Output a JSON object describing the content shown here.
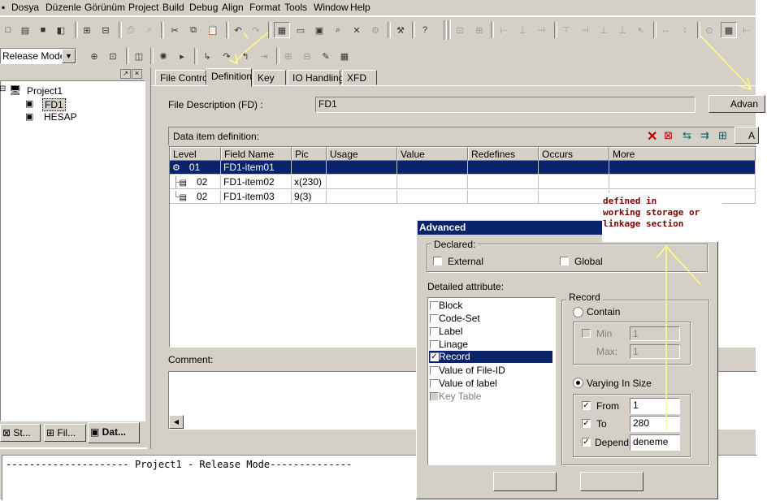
{
  "menubar": {
    "items": [
      "Dosya",
      "Düzenle",
      "Görünüm",
      "Project",
      "Build",
      "Debug",
      "Align",
      "Format",
      "Tools",
      "Window",
      "Help"
    ]
  },
  "toolbar2": {
    "mode_value": "Release Mode"
  },
  "tree": {
    "root": "Project1",
    "children": [
      "FD1",
      "HESAP"
    ]
  },
  "left_tabs": [
    "St...",
    "Fil...",
    "Dat..."
  ],
  "tabs": [
    "File Control",
    "Definition",
    "Key",
    "IO Handling",
    "XFD"
  ],
  "fd": {
    "label": "File Description (FD) :",
    "value": "FD1",
    "advanced_button": "Advan"
  },
  "data_item": {
    "label": "Data item definition:",
    "extra_button": "A",
    "columns": [
      "Level",
      "Field Name",
      "Pic",
      "Usage",
      "Value",
      "Redefines",
      "Occurs",
      "More"
    ],
    "rows": [
      {
        "level": "01",
        "name": "FD1-item01",
        "pic": ""
      },
      {
        "level": "02",
        "name": "FD1-item02",
        "pic": "x(230)"
      },
      {
        "level": "02",
        "name": "FD1-item03",
        "pic": "9(3)"
      }
    ]
  },
  "comment_label": "Comment:",
  "output": {
    "line": "--------------------- Project1 - Release Mode--------------"
  },
  "annotation": {
    "lines": [
      "defined in",
      "working storage or",
      "linkage section"
    ]
  },
  "dialog": {
    "title": "Advanced",
    "declared_label": "Declared:",
    "external_label": "External",
    "global_label": "Global",
    "detailed_label": "Detailed attribute:",
    "attributes": [
      "Block",
      "Code-Set",
      "Label",
      "Linage",
      "Record",
      "Value of File-ID",
      "Value of label",
      "Key Table"
    ],
    "record_group": "Record",
    "contain_label": "Contain",
    "min_label": "Min",
    "min_value": "1",
    "max_label": "Max:",
    "max_value": "1",
    "varying_label": "Varying In Size",
    "from_label": "From",
    "from_value": "1",
    "to_label": "To",
    "to_value": "280",
    "depend_label": "Depend",
    "depend_value": "deneme"
  },
  "colors": {
    "face": "#d4d0c8",
    "selection": "#0a246a",
    "annotation_arrow": "#ffff80",
    "annotation_text": "#800000"
  }
}
